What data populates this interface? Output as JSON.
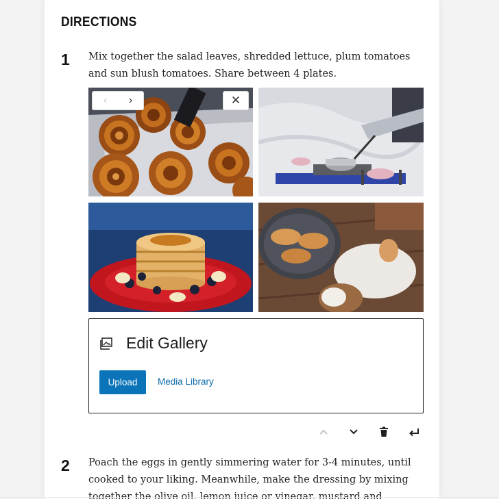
{
  "section": {
    "heading": "DIRECTIONS"
  },
  "steps": [
    {
      "number": "1",
      "text": "Mix together the salad leaves, shredded lettuce, plum tomatoes and sun blush tomatoes. Share between 4 plates."
    },
    {
      "number": "2",
      "text": "Poach the eggs in gently simmering water for 3-4 minutes, until cooked to your liking. Meanwhile, make the dressing by mixing together the olive oil, lemon juice or vinegar, mustard and seasoning."
    }
  ],
  "gallery": {
    "images": [
      {
        "subject": "cinnamon rolls"
      },
      {
        "subject": "cooking on induction hob"
      },
      {
        "subject": "pancake stack with blueberries"
      },
      {
        "subject": "pastries with egg and flour"
      }
    ],
    "selected_index": 0,
    "nav": {
      "prev_icon": "chevron-left-icon",
      "next_icon": "chevron-right-icon",
      "close_icon": "close-icon"
    }
  },
  "placeholder": {
    "title": "Edit Gallery",
    "icon": "gallery-icon",
    "upload_label": "Upload",
    "media_library_label": "Media Library"
  },
  "block_toolbar": {
    "icons": [
      "chevron-up-icon",
      "chevron-down-icon",
      "trash-icon",
      "enter-icon"
    ]
  },
  "colors": {
    "accent": "#0b74b8",
    "selection": "#0a7ac2"
  }
}
